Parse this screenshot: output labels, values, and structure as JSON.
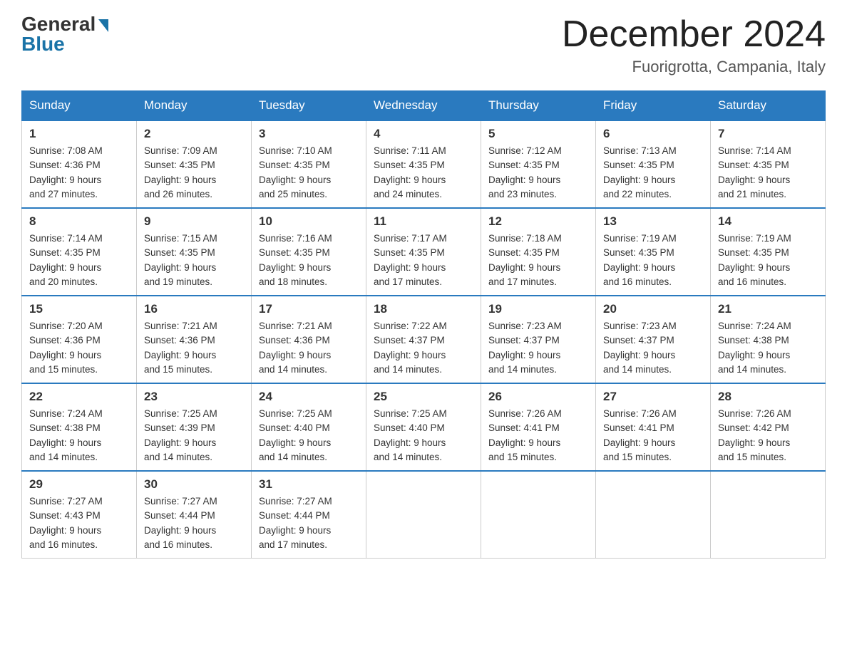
{
  "header": {
    "logo_text": "General",
    "logo_blue": "Blue",
    "month_title": "December 2024",
    "location": "Fuorigrotta, Campania, Italy"
  },
  "weekdays": [
    "Sunday",
    "Monday",
    "Tuesday",
    "Wednesday",
    "Thursday",
    "Friday",
    "Saturday"
  ],
  "weeks": [
    [
      {
        "day": "1",
        "sunrise": "7:08 AM",
        "sunset": "4:36 PM",
        "daylight": "9 hours and 27 minutes."
      },
      {
        "day": "2",
        "sunrise": "7:09 AM",
        "sunset": "4:35 PM",
        "daylight": "9 hours and 26 minutes."
      },
      {
        "day": "3",
        "sunrise": "7:10 AM",
        "sunset": "4:35 PM",
        "daylight": "9 hours and 25 minutes."
      },
      {
        "day": "4",
        "sunrise": "7:11 AM",
        "sunset": "4:35 PM",
        "daylight": "9 hours and 24 minutes."
      },
      {
        "day": "5",
        "sunrise": "7:12 AM",
        "sunset": "4:35 PM",
        "daylight": "9 hours and 23 minutes."
      },
      {
        "day": "6",
        "sunrise": "7:13 AM",
        "sunset": "4:35 PM",
        "daylight": "9 hours and 22 minutes."
      },
      {
        "day": "7",
        "sunrise": "7:14 AM",
        "sunset": "4:35 PM",
        "daylight": "9 hours and 21 minutes."
      }
    ],
    [
      {
        "day": "8",
        "sunrise": "7:14 AM",
        "sunset": "4:35 PM",
        "daylight": "9 hours and 20 minutes."
      },
      {
        "day": "9",
        "sunrise": "7:15 AM",
        "sunset": "4:35 PM",
        "daylight": "9 hours and 19 minutes."
      },
      {
        "day": "10",
        "sunrise": "7:16 AM",
        "sunset": "4:35 PM",
        "daylight": "9 hours and 18 minutes."
      },
      {
        "day": "11",
        "sunrise": "7:17 AM",
        "sunset": "4:35 PM",
        "daylight": "9 hours and 17 minutes."
      },
      {
        "day": "12",
        "sunrise": "7:18 AM",
        "sunset": "4:35 PM",
        "daylight": "9 hours and 17 minutes."
      },
      {
        "day": "13",
        "sunrise": "7:19 AM",
        "sunset": "4:35 PM",
        "daylight": "9 hours and 16 minutes."
      },
      {
        "day": "14",
        "sunrise": "7:19 AM",
        "sunset": "4:35 PM",
        "daylight": "9 hours and 16 minutes."
      }
    ],
    [
      {
        "day": "15",
        "sunrise": "7:20 AM",
        "sunset": "4:36 PM",
        "daylight": "9 hours and 15 minutes."
      },
      {
        "day": "16",
        "sunrise": "7:21 AM",
        "sunset": "4:36 PM",
        "daylight": "9 hours and 15 minutes."
      },
      {
        "day": "17",
        "sunrise": "7:21 AM",
        "sunset": "4:36 PM",
        "daylight": "9 hours and 14 minutes."
      },
      {
        "day": "18",
        "sunrise": "7:22 AM",
        "sunset": "4:37 PM",
        "daylight": "9 hours and 14 minutes."
      },
      {
        "day": "19",
        "sunrise": "7:23 AM",
        "sunset": "4:37 PM",
        "daylight": "9 hours and 14 minutes."
      },
      {
        "day": "20",
        "sunrise": "7:23 AM",
        "sunset": "4:37 PM",
        "daylight": "9 hours and 14 minutes."
      },
      {
        "day": "21",
        "sunrise": "7:24 AM",
        "sunset": "4:38 PM",
        "daylight": "9 hours and 14 minutes."
      }
    ],
    [
      {
        "day": "22",
        "sunrise": "7:24 AM",
        "sunset": "4:38 PM",
        "daylight": "9 hours and 14 minutes."
      },
      {
        "day": "23",
        "sunrise": "7:25 AM",
        "sunset": "4:39 PM",
        "daylight": "9 hours and 14 minutes."
      },
      {
        "day": "24",
        "sunrise": "7:25 AM",
        "sunset": "4:40 PM",
        "daylight": "9 hours and 14 minutes."
      },
      {
        "day": "25",
        "sunrise": "7:25 AM",
        "sunset": "4:40 PM",
        "daylight": "9 hours and 14 minutes."
      },
      {
        "day": "26",
        "sunrise": "7:26 AM",
        "sunset": "4:41 PM",
        "daylight": "9 hours and 15 minutes."
      },
      {
        "day": "27",
        "sunrise": "7:26 AM",
        "sunset": "4:41 PM",
        "daylight": "9 hours and 15 minutes."
      },
      {
        "day": "28",
        "sunrise": "7:26 AM",
        "sunset": "4:42 PM",
        "daylight": "9 hours and 15 minutes."
      }
    ],
    [
      {
        "day": "29",
        "sunrise": "7:27 AM",
        "sunset": "4:43 PM",
        "daylight": "9 hours and 16 minutes."
      },
      {
        "day": "30",
        "sunrise": "7:27 AM",
        "sunset": "4:44 PM",
        "daylight": "9 hours and 16 minutes."
      },
      {
        "day": "31",
        "sunrise": "7:27 AM",
        "sunset": "4:44 PM",
        "daylight": "9 hours and 17 minutes."
      },
      null,
      null,
      null,
      null
    ]
  ],
  "labels": {
    "sunrise": "Sunrise:",
    "sunset": "Sunset:",
    "daylight": "Daylight:"
  }
}
